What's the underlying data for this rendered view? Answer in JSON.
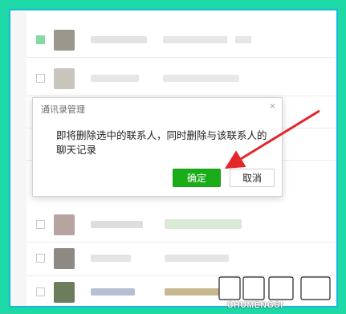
{
  "dialog": {
    "title": "通讯录管理",
    "message": "即将删除选中的联系人，同时删除与该联系人的聊天记录",
    "confirm_label": "确定",
    "cancel_label": "取消",
    "close_glyph": "×"
  },
  "watermark": {
    "brand": "楚萌网",
    "caption": "CHUMENGSI"
  },
  "colors": {
    "frame": "#1ed8a6",
    "border": "#15b9dc",
    "confirm": "#1aad19",
    "arrow": "#e3262a"
  },
  "contacts": [
    {
      "checked": true
    },
    {
      "checked": false
    },
    {
      "checked": false
    },
    {
      "checked": false
    },
    {
      "checked": false
    },
    {
      "checked": false
    },
    {
      "checked": false
    },
    {
      "checked": false
    },
    {
      "checked": false
    }
  ]
}
